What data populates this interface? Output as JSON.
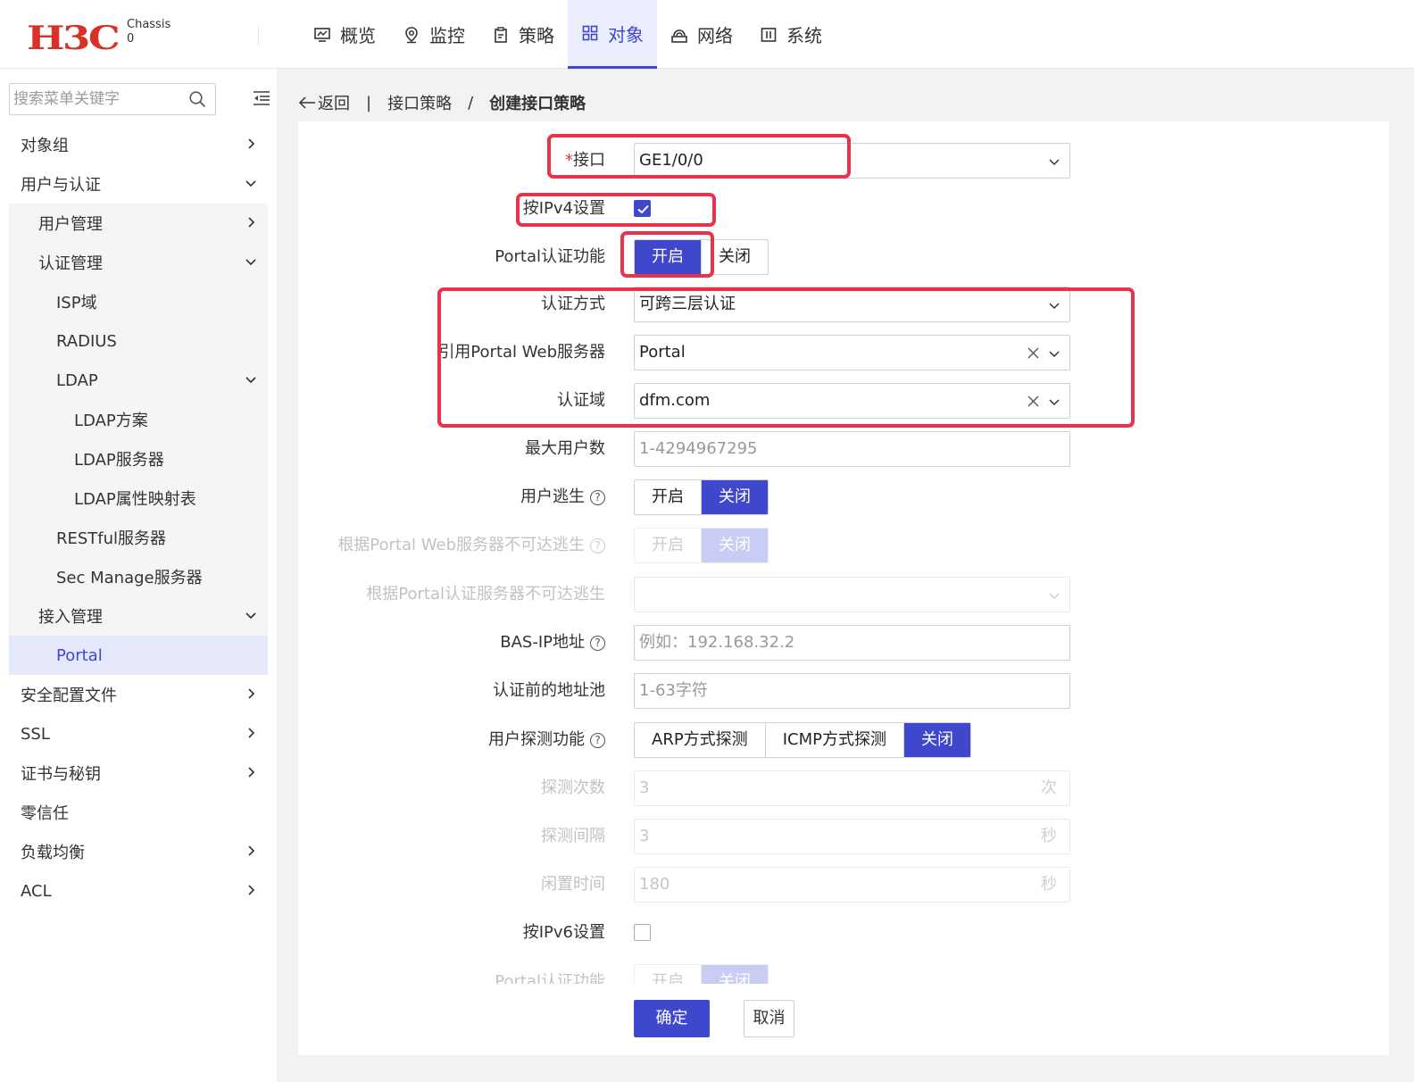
{
  "header": {
    "logo_text": "H3C",
    "chassis_label": "Chassis",
    "chassis_value": "0",
    "nav": [
      {
        "label": "概览",
        "icon": "monitor-icon"
      },
      {
        "label": "监控",
        "icon": "location-icon"
      },
      {
        "label": "策略",
        "icon": "clipboard-icon"
      },
      {
        "label": "对象",
        "icon": "grid-icon",
        "active": true
      },
      {
        "label": "网络",
        "icon": "network-icon"
      },
      {
        "label": "系统",
        "icon": "system-icon"
      }
    ]
  },
  "sidebar": {
    "search_placeholder": "搜索菜单关键字",
    "items": [
      {
        "label": "对象组"
      },
      {
        "label": "用户与认证"
      },
      {
        "label": "用户管理"
      },
      {
        "label": "认证管理"
      },
      {
        "label": "ISP域"
      },
      {
        "label": "RADIUS"
      },
      {
        "label": "LDAP"
      },
      {
        "label": "LDAP方案"
      },
      {
        "label": "LDAP服务器"
      },
      {
        "label": "LDAP属性映射表"
      },
      {
        "label": "RESTful服务器"
      },
      {
        "label": "Sec Manage服务器"
      },
      {
        "label": "接入管理"
      },
      {
        "label": "Portal"
      },
      {
        "label": "安全配置文件"
      },
      {
        "label": "SSL"
      },
      {
        "label": "证书与秘钥"
      },
      {
        "label": "零信任"
      },
      {
        "label": "负载均衡"
      },
      {
        "label": "ACL"
      }
    ]
  },
  "breadcrumb": {
    "back": "返回",
    "parent": "接口策略",
    "separator": "/",
    "current": "创建接口策略"
  },
  "form": {
    "interface": {
      "required_mark": "*",
      "label": "接口",
      "value": "GE1/0/0"
    },
    "ipv4_setting": {
      "label": "按IPv4设置",
      "checked": true
    },
    "portal_auth": {
      "label": "Portal认证功能",
      "on": "开启",
      "off": "关闭",
      "selected": "开启"
    },
    "auth_method": {
      "label": "认证方式",
      "value": "可跨三层认证"
    },
    "portal_web_server": {
      "label": "引用Portal Web服务器",
      "value": "Portal"
    },
    "auth_domain": {
      "label": "认证域",
      "value": "dfm.com"
    },
    "max_users": {
      "label": "最大用户数",
      "placeholder": "1-4294967295"
    },
    "user_escape": {
      "label": "用户逃生",
      "on": "开启",
      "off": "关闭",
      "selected": "关闭"
    },
    "web_server_escape": {
      "label": "根据Portal Web服务器不可达逃生",
      "on": "开启",
      "off": "关闭",
      "selected": "关闭"
    },
    "auth_server_escape": {
      "label": "根据Portal认证服务器不可达逃生",
      "value": ""
    },
    "bas_ip": {
      "label": "BAS-IP地址",
      "placeholder": "例如：192.168.32.2"
    },
    "pre_auth_pool": {
      "label": "认证前的地址池",
      "placeholder": "1-63字符"
    },
    "user_detect": {
      "label": "用户探测功能",
      "options": [
        "ARP方式探测",
        "ICMP方式探测",
        "关闭"
      ],
      "selected": "关闭"
    },
    "detect_count": {
      "label": "探测次数",
      "value": "3",
      "unit": "次"
    },
    "detect_interval": {
      "label": "探测间隔",
      "value": "3",
      "unit": "秒"
    },
    "idle_time": {
      "label": "闲置时间",
      "value": "180",
      "unit": "秒"
    },
    "ipv6_setting": {
      "label": "按IPv6设置",
      "checked": false
    },
    "portal_auth_v6": {
      "label": "Portal认证功能",
      "on": "开启",
      "off": "关闭",
      "selected": "关闭"
    },
    "confirm": "确定",
    "cancel": "取消"
  },
  "colors": {
    "accent": "#3f47cc",
    "highlight": "#e8344a",
    "logo": "#d9302a"
  }
}
